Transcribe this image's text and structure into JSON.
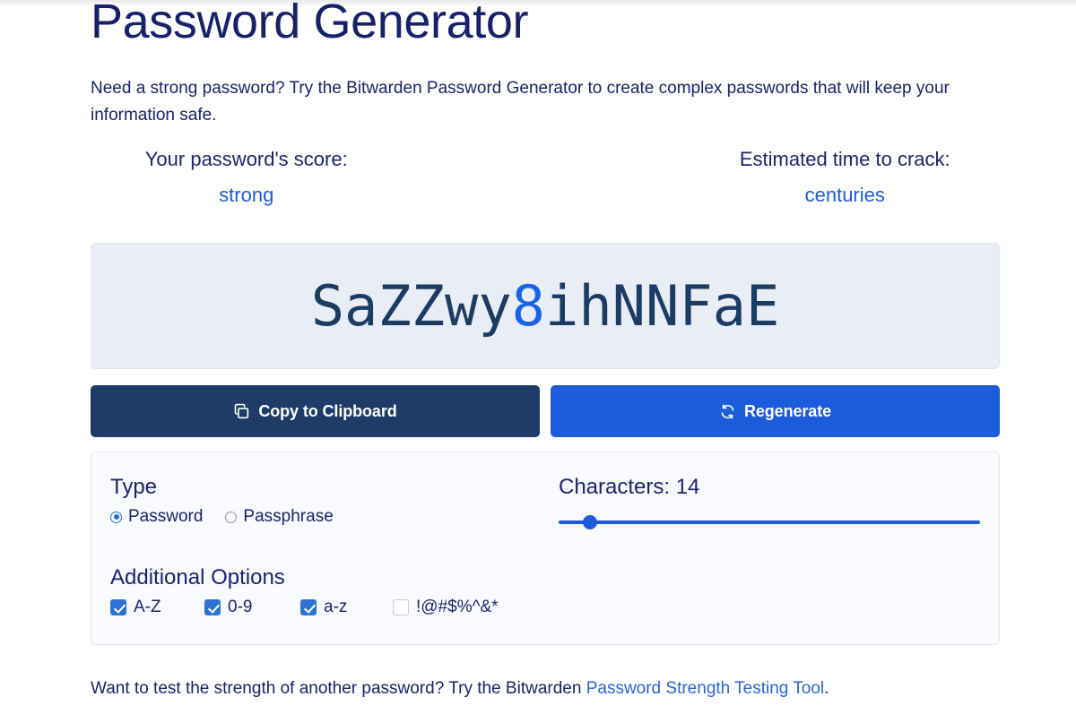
{
  "page": {
    "title": "Password Generator",
    "subtitle": "Need a strong password? Try the Bitwarden Password Generator to create complex passwords that will keep your information safe."
  },
  "meta": {
    "score_label": "Your password's score:",
    "score_value": "strong",
    "crack_label": "Estimated time to crack:",
    "crack_value": "centuries"
  },
  "password": {
    "value": "SaZZwy8ihNNFaE",
    "chars": [
      {
        "c": "S",
        "kind": "letter"
      },
      {
        "c": "a",
        "kind": "letter"
      },
      {
        "c": "Z",
        "kind": "letter"
      },
      {
        "c": "Z",
        "kind": "letter"
      },
      {
        "c": "w",
        "kind": "letter"
      },
      {
        "c": "y",
        "kind": "letter"
      },
      {
        "c": "8",
        "kind": "digit"
      },
      {
        "c": "i",
        "kind": "letter"
      },
      {
        "c": "h",
        "kind": "letter"
      },
      {
        "c": "N",
        "kind": "letter"
      },
      {
        "c": "N",
        "kind": "letter"
      },
      {
        "c": "F",
        "kind": "letter"
      },
      {
        "c": "a",
        "kind": "letter"
      },
      {
        "c": "E",
        "kind": "letter"
      }
    ]
  },
  "buttons": {
    "copy_label": "Copy to Clipboard",
    "copy_icon": "copy-icon",
    "regenerate_label": "Regenerate",
    "regenerate_icon": "refresh-icon"
  },
  "options": {
    "type_heading": "Type",
    "type_options": [
      {
        "label": "Password",
        "selected": true
      },
      {
        "label": "Passphrase",
        "selected": false
      }
    ],
    "length_label": "Characters: 14",
    "length_value": 14,
    "slider_percent": 7.4,
    "additional_heading": "Additional Options",
    "checkboxes": [
      {
        "label": "A-Z",
        "checked": true
      },
      {
        "label": "0-9",
        "checked": true
      },
      {
        "label": "a-z",
        "checked": true
      },
      {
        "label": "!@#$%^&*",
        "checked": false
      }
    ]
  },
  "footer": {
    "text_before": "Want to test the strength of another password? Try the Bitwarden ",
    "link_text": "Password Strength Testing Tool",
    "text_after": "."
  },
  "colors": {
    "navy": "#17216b",
    "accent_blue": "#1c5bd9",
    "dark_button": "#1e3c67",
    "password_box": "#e9edf5",
    "panel": "#f8fafd"
  }
}
